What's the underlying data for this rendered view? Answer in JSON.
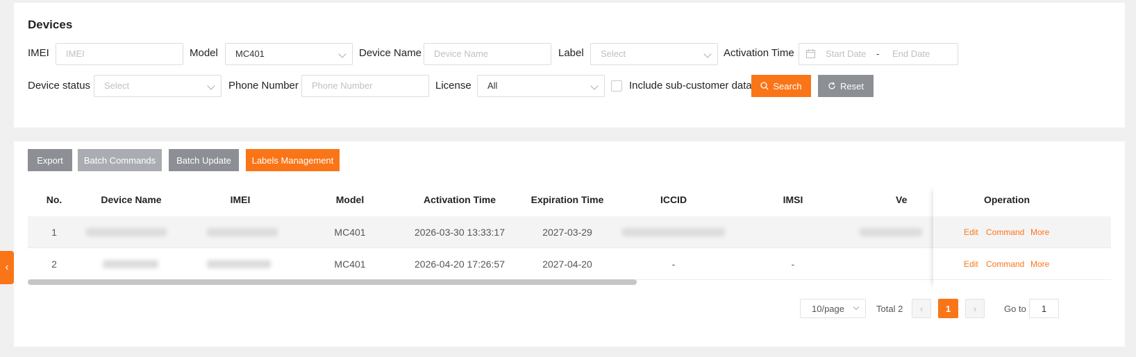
{
  "page": {
    "title": "Devices"
  },
  "filters": {
    "imei": {
      "label": "IMEI",
      "placeholder": "IMEI"
    },
    "model": {
      "label": "Model",
      "value": "MC401"
    },
    "device_name": {
      "label": "Device Name",
      "placeholder": "Device Name"
    },
    "label": {
      "label": "Label",
      "placeholder": "Select"
    },
    "activation_time": {
      "label": "Activation Time",
      "start_placeholder": "Start Date",
      "separator": "-",
      "end_placeholder": "End Date"
    },
    "device_status": {
      "label": "Device status",
      "placeholder": "Select"
    },
    "phone_number": {
      "label": "Phone Number",
      "placeholder": "Phone Number"
    },
    "license": {
      "label": "License",
      "value": "All"
    },
    "include_sub": {
      "label": "Include sub-customer data",
      "checked": false
    },
    "search_label": "Search",
    "reset_label": "Reset"
  },
  "toolbar": {
    "export_label": "Export",
    "batch_commands_label": "Batch Commands",
    "batch_update_label": "Batch Update",
    "labels_management_label": "Labels Management"
  },
  "table": {
    "columns": [
      "No.",
      "Device Name",
      "IMEI",
      "Model",
      "Activation Time",
      "Expiration Time",
      "ICCID",
      "IMSI",
      "Ve",
      "Operation"
    ],
    "rows": [
      {
        "no": "1",
        "model": "MC401",
        "activation": "2026-03-30 13:33:17",
        "expiration": "2027-03-29",
        "iccid": "",
        "imsi": ""
      },
      {
        "no": "2",
        "model": "MC401",
        "activation": "2026-04-20 17:26:57",
        "expiration": "2027-04-20",
        "iccid": "-",
        "imsi": "-"
      }
    ],
    "ops": {
      "edit": "Edit",
      "command": "Command",
      "more": "More"
    }
  },
  "pagination": {
    "page_size": "10/page",
    "total": "Total 2",
    "current_page": "1",
    "goto_label": "Go to",
    "goto_value": "1"
  },
  "colors": {
    "accent": "#fa7517",
    "gray_button": "#8c8f94"
  },
  "icons": [
    "calendar-icon",
    "search-icon",
    "refresh-icon",
    "chevron-down-icon",
    "chevron-left-icon",
    "chevron-right-icon"
  ]
}
